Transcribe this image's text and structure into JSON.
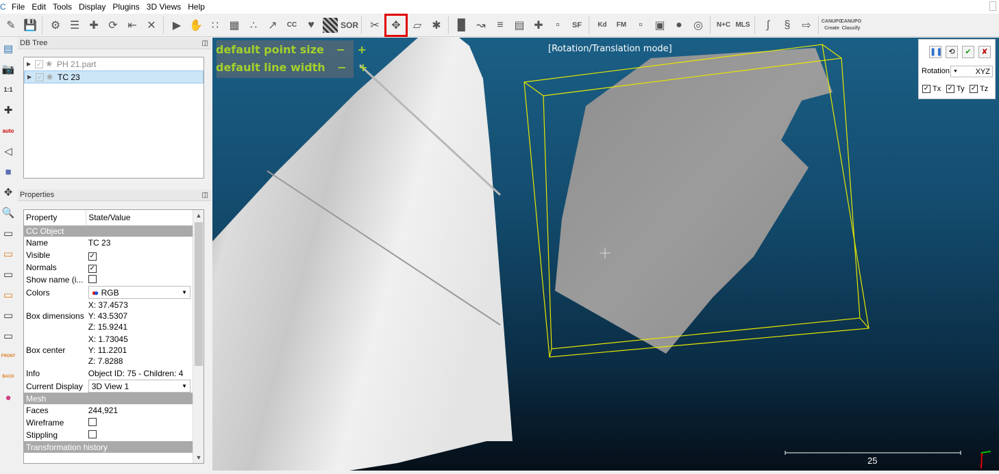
{
  "menu": [
    "File",
    "Edit",
    "Tools",
    "Display",
    "Plugins",
    "3D Views",
    "Help"
  ],
  "toolbar": {
    "sor_label": "SOR",
    "sf_label": "SF",
    "kd_label": "Kd",
    "fm_label": "FM",
    "nc_label": "N+C",
    "mls_label": "MLS",
    "canupo_create": "Create",
    "canupo_classify": "Classify",
    "canupo_top": "CANUPO"
  },
  "left_toolbar": {
    "one_to_one": "1:1",
    "auto": "auto",
    "front": "FRONT",
    "back": "BACK"
  },
  "db_tree": {
    "title": "DB Tree",
    "items": [
      {
        "label": "PH 21.part"
      },
      {
        "label": "TC 23"
      }
    ]
  },
  "properties": {
    "title": "Properties",
    "header_property": "Property",
    "header_value": "State/Value",
    "section_cc": "CC Object",
    "name_key": "Name",
    "name_val": "TC 23",
    "visible_key": "Visible",
    "normals_key": "Normals",
    "showname_key": "Show name (i...",
    "colors_key": "Colors",
    "colors_val": "RGB",
    "boxdim_key": "Box dimensions",
    "boxdim_x": "X: 37.4573",
    "boxdim_y": "Y: 43.5307",
    "boxdim_z": "Z: 15.9241",
    "boxcenter_key": "Box center",
    "boxcenter_x": "X: 1.73045",
    "boxcenter_y": "Y: 11.2201",
    "boxcenter_z": "Z: 7.8288",
    "info_key": "Info",
    "info_val": "Object ID: 75 - Children: 4",
    "display_key": "Current Display",
    "display_val": "3D View 1",
    "section_mesh": "Mesh",
    "faces_key": "Faces",
    "faces_val": "244,921",
    "wireframe_key": "Wireframe",
    "stippling_key": "Stippling",
    "section_transform": "Transformation history"
  },
  "view": {
    "point_size_label": "default point size",
    "line_width_label": "default line width",
    "minus": "−",
    "plus": "+",
    "mode_label": "[Rotation/Translation mode]",
    "scale_value": "25"
  },
  "transform_panel": {
    "rotation_label": "Rotation",
    "rotation_axes": "XYZ",
    "tx": "Tx",
    "ty": "Ty",
    "tz": "Tz"
  },
  "colors": {
    "overlay_text": "#a4d02b",
    "bbox": "#e8e800",
    "highlight": "#e00000",
    "confirm": "#1a9a1a",
    "cancel": "#c00000"
  }
}
